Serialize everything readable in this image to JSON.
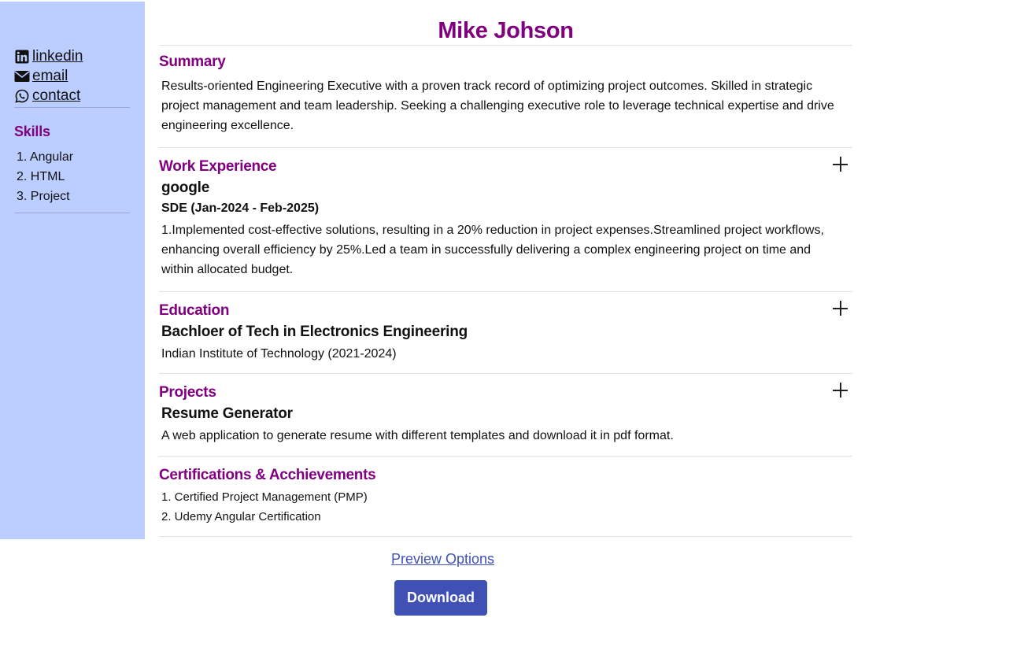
{
  "sidebar": {
    "contacts": [
      {
        "icon": "linkedin-icon",
        "label": "linkedin"
      },
      {
        "icon": "envelope-icon",
        "label": "email"
      },
      {
        "icon": "whatsapp-icon",
        "label": "contact"
      }
    ],
    "skills_title": "Skills",
    "skills": [
      "1. Angular",
      "2. HTML",
      "3. Project"
    ]
  },
  "resume": {
    "name": "Mike Johson",
    "summary": {
      "title": "Summary",
      "text": "Results-oriented Engineering Executive with a proven track record of optimizing project outcomes. Skilled in strategic project management and team leadership. Seeking a challenging executive role to leverage technical expertise and drive engineering excellence."
    },
    "work": {
      "title": "Work Experience",
      "company": "google",
      "role": "SDE (Jan-2024 - Feb-2025)",
      "description": "1.Implemented cost-effective solutions, resulting in a 20% reduction in project expenses.Streamlined project workflows, enhancing overall efficiency by 25%.Led a team in successfully delivering a complex engineering project on time and within allocated budget."
    },
    "education": {
      "title": "Education",
      "degree": "Bachloer of Tech in Electronics Engineering",
      "school": "Indian Institute of Technology (2021-2024)"
    },
    "projects": {
      "title": "Projects",
      "name": "Resume Generator",
      "description": "A web application to generate resume with different templates and download it in pdf format."
    },
    "certifications": {
      "title": "Certifications & Acchievements",
      "items": [
        "1. Certified Project Management (PMP)",
        "2. Udemy Angular Certification"
      ]
    }
  },
  "actions": {
    "preview_label": "Preview Options",
    "download_label": "Download"
  },
  "colors": {
    "sidebar_bg": "#bccdff",
    "heading": "#800080",
    "accent": "#3f51b5"
  }
}
